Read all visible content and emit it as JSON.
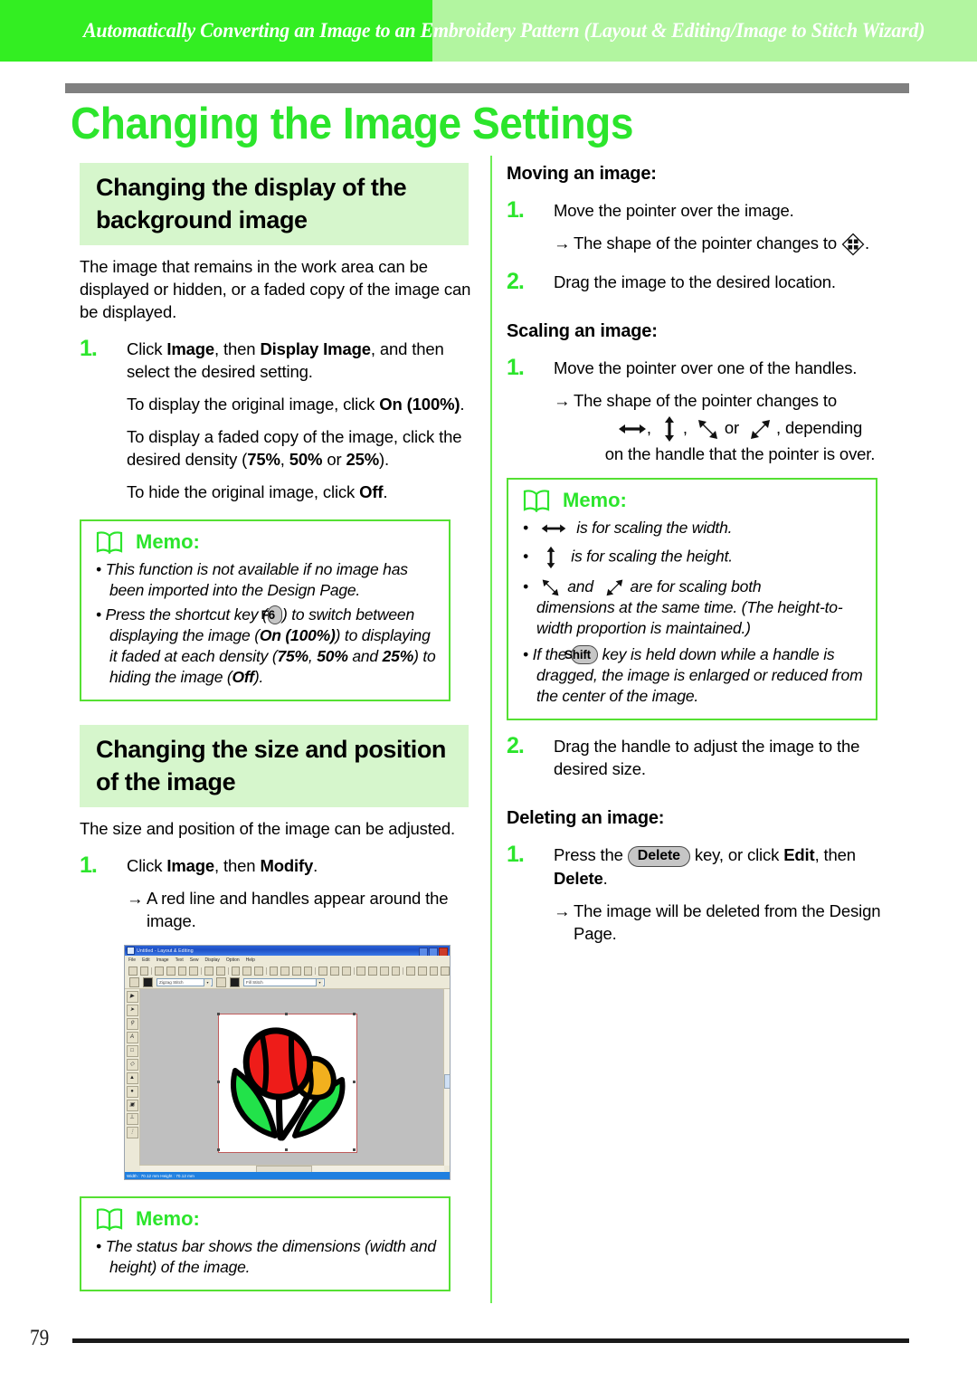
{
  "header": {
    "running_title": "Automatically Converting an Image to an Embroidery Pattern (Layout & Editing/Image to Stitch Wizard)",
    "band_bright_color": "#33ee22",
    "band_light_color": "#b2f5a0"
  },
  "page_title": "Changing the Image Settings",
  "accent_green": "#2ce52c",
  "left_column": {
    "section1": {
      "heading": "Changing the display of the background image",
      "intro": "The image that remains in the work area can be displayed or hidden, or a faded copy of the image can be displayed.",
      "step1": {
        "number": "1.",
        "line1_a": "Click ",
        "line1_b": "Image",
        "line1_c": ", then ",
        "line1_d": "Display Image",
        "line1_e": ", and then select the desired setting.",
        "p1_a": "To display the original image, click ",
        "p1_b": "On (100%)",
        "p1_c": ".",
        "p2_a": "To display a faded copy of the image, click the desired density (",
        "p2_b": "75%",
        "p2_c": ", ",
        "p2_d": "50%",
        "p2_e": " or ",
        "p2_f": "25%",
        "p2_g": ").",
        "p3_a": "To hide the original image, click ",
        "p3_b": "Off",
        "p3_c": "."
      },
      "memo": {
        "label": "Memo:",
        "bullet1": "This function is not available if no image has been imported into the Design Page.",
        "bullet2_a": "Press the shortcut key (",
        "bullet2_key": "F6",
        "bullet2_b": ") to switch between displaying the image (",
        "bullet2_c": "On (100%)",
        "bullet2_d": ") to displaying it faded at each density (",
        "bullet2_e": "75%",
        "bullet2_f": ", ",
        "bullet2_g": "50%",
        "bullet2_h": " and ",
        "bullet2_i": "25%",
        "bullet2_j": ") to hiding the image (",
        "bullet2_k": "Off",
        "bullet2_l": ")."
      }
    },
    "section2": {
      "heading": "Changing the size and position of the image",
      "intro": "The size and position of the image can be adjusted.",
      "step1": {
        "number": "1.",
        "line1_a": "Click ",
        "line1_b": "Image",
        "line1_c": ", then ",
        "line1_d": "Modify",
        "line1_e": ".",
        "arrow": "→",
        "result": "A red line and handles appear around the image."
      },
      "screenshot": {
        "window_title": "Untitled - Layout & Editing",
        "menu_items": [
          "File",
          "Edit",
          "Image",
          "Text",
          "Sew",
          "Display",
          "Option",
          "Help"
        ],
        "combo1_value": "Zigzag Stitch",
        "combo2_value": "Fill Stitch",
        "status_text": "Width : 70.12 mm  Height : 70.12 mm",
        "canvas_color": "#bfbfbf",
        "selection_border_color": "#c05b5b"
      },
      "memo": {
        "label": "Memo:",
        "bullet1": "The status bar shows the dimensions (width and height) of the image."
      }
    }
  },
  "right_column": {
    "moving": {
      "heading": "Moving an image:",
      "step1": {
        "number": "1.",
        "text": "Move the pointer over the image.",
        "arrow": "→",
        "result_a": "The shape of the pointer changes to",
        "result_icon": "move-cursor-icon",
        "result_b": "."
      },
      "step2": {
        "number": "2.",
        "text": "Drag the image to the desired location."
      }
    },
    "scaling": {
      "heading": "Scaling an image:",
      "step1": {
        "number": "1.",
        "text": "Move the pointer over one of the handles.",
        "arrow": "→",
        "result_line1": "The shape of the pointer changes to",
        "result_sep1": ",",
        "result_sep2": ",",
        "result_or": "or",
        "result_tail": ", depending",
        "result_line3": "on the handle that the pointer is over."
      },
      "memo": {
        "label": "Memo:",
        "bullet1": "is for scaling the width.",
        "bullet2": "is for scaling the height.",
        "bullet3_a": "and",
        "bullet3_b": "are for scaling both",
        "bullet3_c": "dimensions at the same time. (The height-to-width proportion is maintained.)",
        "bullet4_a": "If the ",
        "bullet4_key": "Shift",
        "bullet4_b": " key is held down while a handle is dragged, the image is enlarged or reduced from the center of the image."
      },
      "step2": {
        "number": "2.",
        "text": "Drag the handle to adjust the image to the desired size."
      }
    },
    "deleting": {
      "heading": "Deleting an image:",
      "step1": {
        "number": "1.",
        "text_a": "Press the ",
        "key": "Delete",
        "text_b": " key, or click ",
        "text_c": "Edit",
        "text_d": ", then ",
        "text_e": "Delete",
        "text_f": ".",
        "arrow": "→",
        "result": "The image will be deleted from the Design Page."
      }
    }
  },
  "footer": {
    "page_number": "79"
  }
}
